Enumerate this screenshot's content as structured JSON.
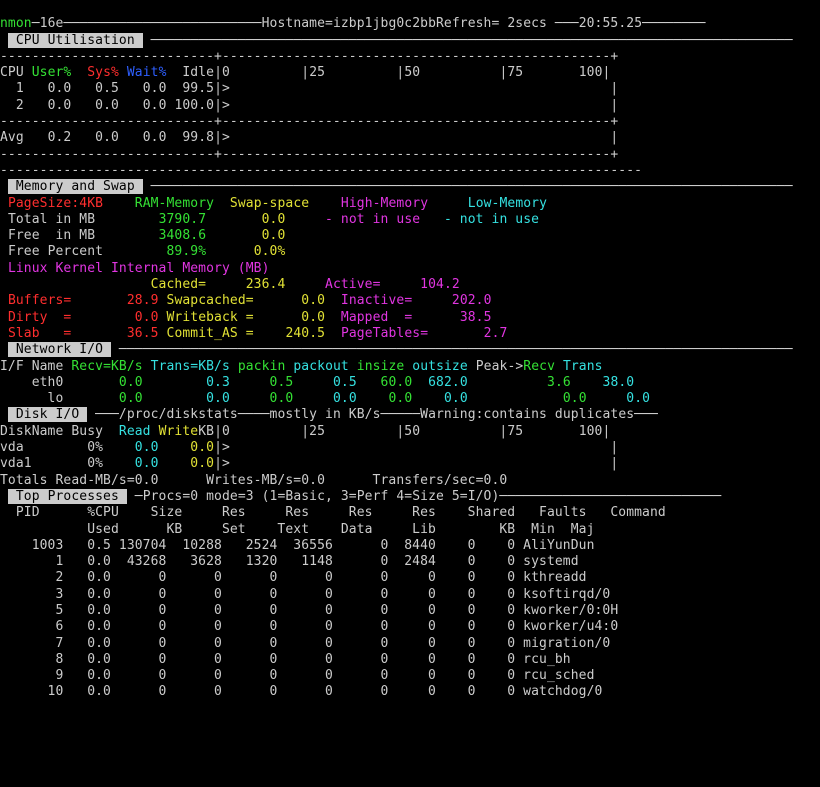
{
  "top": {
    "prog": "nmon",
    "ver": "16e",
    "hostname": "izbp1jbg0c2bb",
    "refresh": "2secs",
    "time": "20:55.25",
    "dash3": "───",
    "hostlabel": "Hostname=",
    "reflabel": "Refresh= ",
    "dashmid": "─────────────────────────",
    "dashend": "────────"
  },
  "titles": {
    "cpu": " CPU Utilisation ",
    "mem": " Memory and Swap ",
    "net": " Network I/O ",
    "disk": " Disk I/O ",
    "top": " Top Processes "
  },
  "cpu": {
    "hdr_cpu": "CPU",
    "hdr_user": "User%",
    "hdr_sys": "Sys%",
    "hdr_wait": "Wait%",
    "hdr_idle": "Idle",
    "hdr_scale_line": "|0         |25         |50          |75       100|",
    "row1": {
      "n": "  1",
      "u": "  0.0",
      "s": "  0.5",
      "w": "  0.0",
      "i": " 99.5",
      "bar": "|>                                                |"
    },
    "row2": {
      "n": "  2",
      "u": "  0.0",
      "s": "  0.0",
      "w": "  0.0",
      "i": "100.0",
      "bar": "|>                                                |"
    },
    "avg": {
      "n": "Avg",
      "u": "  0.2",
      "s": "  0.0",
      "w": "  0.0",
      "i": " 99.8",
      "bar": "|>                                                |"
    },
    "sep": "---------------------------+-------------------------------------------------+",
    "tail": "---------------------------------------------------------------------------------"
  },
  "mem": {
    "pagesize_lbl": "PageSize:4KB",
    "ram_lbl": "RAM-Memory",
    "swap_lbl": "Swap-space",
    "high_lbl": "High-Memory",
    "low_lbl": "Low-Memory",
    "tot_lbl": "Total in MB",
    "tot_ram": "3790.7",
    "tot_swap": "0.0",
    "not_in_use": "- not in use",
    "free_lbl": "Free  in MB",
    "free_ram": "3408.6",
    "free_swap": "0.0",
    "pct_lbl": "Free Percent",
    "pct_ram": "89.9%",
    "pct_swap": "0.0%",
    "kline": "Linux Kernel Internal Memory (MB)",
    "kcol_cached": "Cached=",
    "kcol_active": "Active=",
    "kcol_buffers": "Buffers=",
    "kcol_swapcached": "Swapcached=",
    "kcol_inactive": "Inactive=",
    "kcol_dirty": "Dirty  =",
    "kcol_writeback": "Writeback =",
    "kcol_mapped": "Mapped  =",
    "kcol_slab": "Slab   =",
    "kcol_commit": "Commit_AS =",
    "kcol_pagetab": "PageTables=",
    "val_cached": "236.4",
    "val_active": "104.2",
    "val_buffers": "28.9",
    "val_swapcached": "0.0",
    "val_inactive": "202.0",
    "val_dirty": "0.0",
    "val_writeback": "0.0",
    "val_mapped": "38.5",
    "val_slab": "36.5",
    "val_commit": "240.5",
    "val_pagetab": "2.7"
  },
  "net": {
    "hdr_if": "I/F Name",
    "hdr_recv": "Recv=KB/s",
    "hdr_trans": "Trans=KB/s",
    "hdr_pkin": "packin",
    "hdr_pkout": "packout",
    "hdr_insz": "insize",
    "hdr_outsz": "outsize",
    "hdr_peak": "Peak->",
    "hdr_precv": "Recv",
    "hdr_ptrans": "Trans",
    "row1": {
      "n": "    eth0",
      "r": "   0.0",
      "t": "   0.3",
      "pi": "  0.5",
      "po": "  0.5",
      "is": " 60.0",
      "os": "682.0",
      "pr": "   3.6",
      "pt": "  38.0"
    },
    "row2": {
      "n": "      lo",
      "r": "   0.0",
      "t": "   0.0",
      "pi": "  0.0",
      "po": "  0.0",
      "is": "  0.0",
      "os": "  0.0",
      "pr": "   0.0",
      "pt": "   0.0"
    }
  },
  "disk": {
    "title_tail": "───/proc/diskstats────mostly in KB/s─────Warning:contains duplicates───",
    "hdr": "DiskName Busy  Read WriteKB",
    "scale": "|0         |25         |50          |75       100|",
    "row1": {
      "n": "vda       ",
      "b": " 0%",
      "r": "  0.0",
      "w": "  0.0",
      "bar": "|>                                                |"
    },
    "row2": {
      "n": "vda1      ",
      "b": " 0%",
      "r": "  0.0",
      "w": "  0.0",
      "bar": "|>                                                |"
    },
    "totals": "Totals Read-MB/s=0.0      Writes-MB/s=0.0      Transfers/sec=0.0"
  },
  "proc": {
    "title_tail": "─Procs=0 mode=3 (1=Basic, 3=Perf 4=Size 5=I/O)────────────────────────────",
    "hdr1": "  PID      %CPU    Size     Res     Res     Res     Res    Shared   Faults   Command",
    "hdr2": "           Used      KB     Set    Text    Data     Lib        KB  Min  Maj",
    "rows": [
      {
        "p": "    1003",
        "c": "   0.5",
        "sz": " 130704",
        "rs": "  10288",
        "rt": "   2524",
        "rd": "  36556",
        "rl": "      0",
        "sh": "  8440",
        "fm": "    0",
        "fj": "    0",
        "cmd": " AliYunDun"
      },
      {
        "p": "       1",
        "c": "   0.0",
        "sz": "  43268",
        "rs": "   3628",
        "rt": "   1320",
        "rd": "   1148",
        "rl": "      0",
        "sh": "  2484",
        "fm": "    0",
        "fj": "    0",
        "cmd": " systemd"
      },
      {
        "p": "       2",
        "c": "   0.0",
        "sz": "      0",
        "rs": "      0",
        "rt": "      0",
        "rd": "      0",
        "rl": "      0",
        "sh": "     0",
        "fm": "    0",
        "fj": "    0",
        "cmd": " kthreadd"
      },
      {
        "p": "       3",
        "c": "   0.0",
        "sz": "      0",
        "rs": "      0",
        "rt": "      0",
        "rd": "      0",
        "rl": "      0",
        "sh": "     0",
        "fm": "    0",
        "fj": "    0",
        "cmd": " ksoftirqd/0"
      },
      {
        "p": "       5",
        "c": "   0.0",
        "sz": "      0",
        "rs": "      0",
        "rt": "      0",
        "rd": "      0",
        "rl": "      0",
        "sh": "     0",
        "fm": "    0",
        "fj": "    0",
        "cmd": " kworker/0:0H"
      },
      {
        "p": "       6",
        "c": "   0.0",
        "sz": "      0",
        "rs": "      0",
        "rt": "      0",
        "rd": "      0",
        "rl": "      0",
        "sh": "     0",
        "fm": "    0",
        "fj": "    0",
        "cmd": " kworker/u4:0"
      },
      {
        "p": "       7",
        "c": "   0.0",
        "sz": "      0",
        "rs": "      0",
        "rt": "      0",
        "rd": "      0",
        "rl": "      0",
        "sh": "     0",
        "fm": "    0",
        "fj": "    0",
        "cmd": " migration/0"
      },
      {
        "p": "       8",
        "c": "   0.0",
        "sz": "      0",
        "rs": "      0",
        "rt": "      0",
        "rd": "      0",
        "rl": "      0",
        "sh": "     0",
        "fm": "    0",
        "fj": "    0",
        "cmd": " rcu_bh"
      },
      {
        "p": "       9",
        "c": "   0.0",
        "sz": "      0",
        "rs": "      0",
        "rt": "      0",
        "rd": "      0",
        "rl": "      0",
        "sh": "     0",
        "fm": "    0",
        "fj": "    0",
        "cmd": " rcu_sched"
      },
      {
        "p": "      10",
        "c": "   0.0",
        "sz": "      0",
        "rs": "      0",
        "rt": "      0",
        "rd": "      0",
        "rl": "      0",
        "sh": "     0",
        "fm": "    0",
        "fj": "    0",
        "cmd": " watchdog/0"
      }
    ]
  }
}
